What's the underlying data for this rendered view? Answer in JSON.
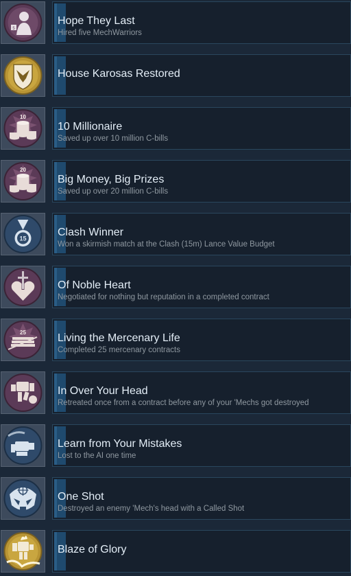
{
  "achievements": [
    {
      "title": "Hope They Last",
      "desc": "Hired five MechWarriors",
      "icon": "mechwarrior-portrait-icon",
      "badge": "5"
    },
    {
      "title": "House Karosas Restored",
      "desc": "",
      "icon": "house-crest-shield-icon",
      "badge": ""
    },
    {
      "title": "10 Millionaire",
      "desc": "Saved up over 10 million C-bills",
      "icon": "coin-stacks-icon",
      "badge": "10"
    },
    {
      "title": "Big Money, Big Prizes",
      "desc": "Saved up over 20 million C-bills",
      "icon": "coin-stacks-icon",
      "badge": "20"
    },
    {
      "title": "Clash Winner",
      "desc": "Won a skirmish match at the Clash (15m) Lance Value Budget",
      "icon": "medal-icon",
      "badge": "15"
    },
    {
      "title": "Of Noble Heart",
      "desc": "Negotiated for nothing but reputation in a completed contract",
      "icon": "sword-heart-icon",
      "badge": ""
    },
    {
      "title": "Living the Mercenary Life",
      "desc": "Completed 25 mercenary contracts",
      "icon": "contract-stack-icon",
      "badge": "25"
    },
    {
      "title": "In Over Your Head",
      "desc": "Retreated once from a contract before any of your 'Mechs got destroyed",
      "icon": "retreating-mech-icon",
      "badge": ""
    },
    {
      "title": "Learn from Your Mistakes",
      "desc": "Lost to the AI one time",
      "icon": "fallen-mech-icon",
      "badge": ""
    },
    {
      "title": "One Shot",
      "desc": "Destroyed an enemy 'Mech's head with a Called Shot",
      "icon": "crosshair-skull-icon",
      "badge": ""
    },
    {
      "title": "Blaze of Glory",
      "desc": "",
      "icon": "flaming-mech-icon",
      "badge": ""
    }
  ],
  "colors": {
    "background": "#1b2838",
    "accent": "#2a5d86",
    "icon_purple": "#5c3a56",
    "icon_blue": "#2f4a6a",
    "icon_gold": "#c9a640"
  }
}
